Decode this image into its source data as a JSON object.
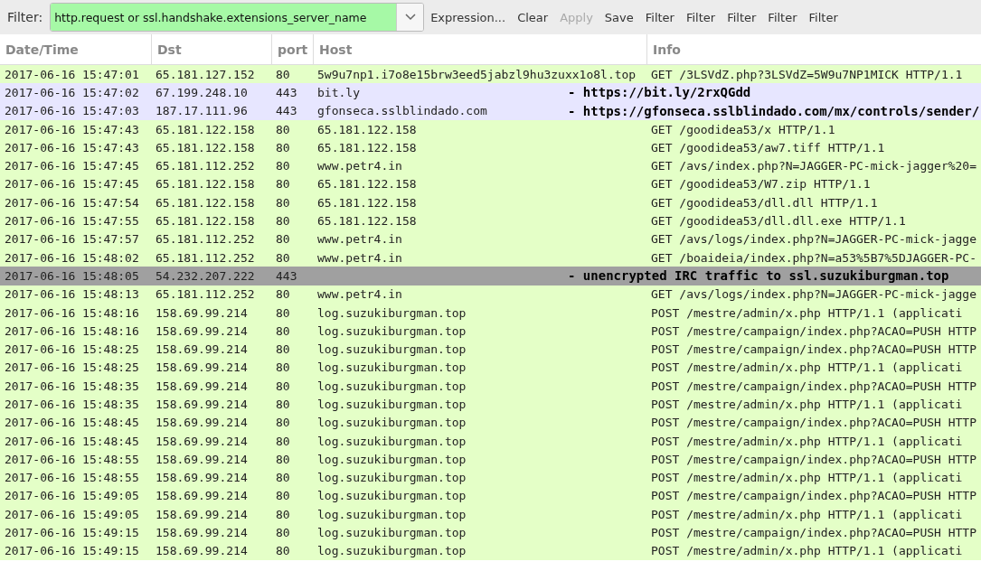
{
  "toolbar": {
    "label": "Filter:",
    "filter": {
      "value": "http.request or ssl.handshake.extensions_server_name",
      "valid": true
    },
    "buttons": [
      {
        "label": "Expression...",
        "disabled": false
      },
      {
        "label": "Clear",
        "disabled": false
      },
      {
        "label": "Apply",
        "disabled": true
      },
      {
        "label": "Save",
        "disabled": false
      },
      {
        "label": "Filter",
        "disabled": false
      },
      {
        "label": "Filter",
        "disabled": false
      },
      {
        "label": "Filter",
        "disabled": false
      },
      {
        "label": "Filter",
        "disabled": false
      },
      {
        "label": "Filter",
        "disabled": false
      }
    ]
  },
  "table": {
    "columns": [
      "Date/Time",
      "Dst",
      "port",
      "Host",
      "Info"
    ],
    "rows": [
      {
        "kind": "http",
        "color": "#e4ffc7",
        "time": "2017-06-16 15:47:01",
        "dst": "65.181.127.152",
        "port": "80",
        "host": "5w9u7np1.i7o8e15brw3eed5jabzl9hu3zuxx1o8l.top",
        "info": "GET /3LSVdZ.php?3LSVdZ=5W9u7NP1MICK HTTP/1.1"
      },
      {
        "kind": "ssl",
        "color": "#e7e6ff",
        "time": "2017-06-16 15:47:02",
        "dst": "67.199.248.10",
        "port": "443",
        "host": "bit.ly",
        "info": "- https://bit.ly/2rxQGdd"
      },
      {
        "kind": "ssl",
        "color": "#e7e6ff",
        "time": "2017-06-16 15:47:03",
        "dst": "187.17.111.96",
        "port": "443",
        "host": "gfonseca.sslblindado.com",
        "info": "- https://gfonseca.sslblindado.com/mx/controls/sender/"
      },
      {
        "kind": "http",
        "color": "#e4ffc7",
        "time": "2017-06-16 15:47:43",
        "dst": "65.181.122.158",
        "port": "80",
        "host": "65.181.122.158",
        "info": "GET /goodidea53/x HTTP/1.1"
      },
      {
        "kind": "http",
        "color": "#e4ffc7",
        "time": "2017-06-16 15:47:43",
        "dst": "65.181.122.158",
        "port": "80",
        "host": "65.181.122.158",
        "info": "GET /goodidea53/aw7.tiff HTTP/1.1"
      },
      {
        "kind": "http",
        "color": "#e4ffc7",
        "time": "2017-06-16 15:47:45",
        "dst": "65.181.112.252",
        "port": "80",
        "host": "www.petr4.in",
        "info": "GET /avs/index.php?N=JAGGER-PC-mick-jagger%20="
      },
      {
        "kind": "http",
        "color": "#e4ffc7",
        "time": "2017-06-16 15:47:45",
        "dst": "65.181.122.158",
        "port": "80",
        "host": "65.181.122.158",
        "info": "GET /goodidea53/W7.zip HTTP/1.1"
      },
      {
        "kind": "http",
        "color": "#e4ffc7",
        "time": "2017-06-16 15:47:54",
        "dst": "65.181.122.158",
        "port": "80",
        "host": "65.181.122.158",
        "info": "GET /goodidea53/dll.dll HTTP/1.1"
      },
      {
        "kind": "http",
        "color": "#e4ffc7",
        "time": "2017-06-16 15:47:55",
        "dst": "65.181.122.158",
        "port": "80",
        "host": "65.181.122.158",
        "info": "GET /goodidea53/dll.dll.exe HTTP/1.1"
      },
      {
        "kind": "http",
        "color": "#e4ffc7",
        "time": "2017-06-16 15:47:57",
        "dst": "65.181.112.252",
        "port": "80",
        "host": "www.petr4.in",
        "info": "GET /avs/logs/index.php?N=JAGGER-PC-mick-jagge"
      },
      {
        "kind": "http",
        "color": "#e4ffc7",
        "time": "2017-06-16 15:48:02",
        "dst": "65.181.112.252",
        "port": "80",
        "host": "www.petr4.in",
        "info": "GET /boaideia/index.php?N=a53%5B7%5DJAGGER-PC-"
      },
      {
        "kind": "irc",
        "color": "#a0a0a0",
        "time": "2017-06-16 15:48:05",
        "dst": "54.232.207.222",
        "port": "443",
        "info": "- unencrypted IRC traffic to ssl.suzukiburgman.top"
      },
      {
        "kind": "http",
        "color": "#e4ffc7",
        "time": "2017-06-16 15:48:13",
        "dst": "65.181.112.252",
        "port": "80",
        "host": "www.petr4.in",
        "info": "GET /avs/logs/index.php?N=JAGGER-PC-mick-jagge"
      },
      {
        "kind": "http",
        "color": "#e4ffc7",
        "time": "2017-06-16 15:48:16",
        "dst": "158.69.99.214",
        "port": "80",
        "host": "log.suzukiburgman.top",
        "info": "POST /mestre/admin/x.php HTTP/1.1  (applicati"
      },
      {
        "kind": "http",
        "color": "#e4ffc7",
        "time": "2017-06-16 15:48:16",
        "dst": "158.69.99.214",
        "port": "80",
        "host": "log.suzukiburgman.top",
        "info": "POST /mestre/campaign/index.php?ACAO=PUSH HTTP"
      },
      {
        "kind": "http",
        "color": "#e4ffc7",
        "time": "2017-06-16 15:48:25",
        "dst": "158.69.99.214",
        "port": "80",
        "host": "log.suzukiburgman.top",
        "info": "POST /mestre/campaign/index.php?ACAO=PUSH HTTP"
      },
      {
        "kind": "http",
        "color": "#e4ffc7",
        "time": "2017-06-16 15:48:25",
        "dst": "158.69.99.214",
        "port": "80",
        "host": "log.suzukiburgman.top",
        "info": "POST /mestre/admin/x.php HTTP/1.1  (applicati"
      },
      {
        "kind": "http",
        "color": "#e4ffc7",
        "time": "2017-06-16 15:48:35",
        "dst": "158.69.99.214",
        "port": "80",
        "host": "log.suzukiburgman.top",
        "info": "POST /mestre/campaign/index.php?ACAO=PUSH HTTP"
      },
      {
        "kind": "http",
        "color": "#e4ffc7",
        "time": "2017-06-16 15:48:35",
        "dst": "158.69.99.214",
        "port": "80",
        "host": "log.suzukiburgman.top",
        "info": "POST /mestre/admin/x.php HTTP/1.1  (applicati"
      },
      {
        "kind": "http",
        "color": "#e4ffc7",
        "time": "2017-06-16 15:48:45",
        "dst": "158.69.99.214",
        "port": "80",
        "host": "log.suzukiburgman.top",
        "info": "POST /mestre/campaign/index.php?ACAO=PUSH HTTP"
      },
      {
        "kind": "http",
        "color": "#e4ffc7",
        "time": "2017-06-16 15:48:45",
        "dst": "158.69.99.214",
        "port": "80",
        "host": "log.suzukiburgman.top",
        "info": "POST /mestre/admin/x.php HTTP/1.1  (applicati"
      },
      {
        "kind": "http",
        "color": "#e4ffc7",
        "time": "2017-06-16 15:48:55",
        "dst": "158.69.99.214",
        "port": "80",
        "host": "log.suzukiburgman.top",
        "info": "POST /mestre/campaign/index.php?ACAO=PUSH HTTP"
      },
      {
        "kind": "http",
        "color": "#e4ffc7",
        "time": "2017-06-16 15:48:55",
        "dst": "158.69.99.214",
        "port": "80",
        "host": "log.suzukiburgman.top",
        "info": "POST /mestre/admin/x.php HTTP/1.1  (applicati"
      },
      {
        "kind": "http",
        "color": "#e4ffc7",
        "time": "2017-06-16 15:49:05",
        "dst": "158.69.99.214",
        "port": "80",
        "host": "log.suzukiburgman.top",
        "info": "POST /mestre/campaign/index.php?ACAO=PUSH HTTP"
      },
      {
        "kind": "http",
        "color": "#e4ffc7",
        "time": "2017-06-16 15:49:05",
        "dst": "158.69.99.214",
        "port": "80",
        "host": "log.suzukiburgman.top",
        "info": "POST /mestre/admin/x.php HTTP/1.1  (applicati"
      },
      {
        "kind": "http",
        "color": "#e4ffc7",
        "time": "2017-06-16 15:49:15",
        "dst": "158.69.99.214",
        "port": "80",
        "host": "log.suzukiburgman.top",
        "info": "POST /mestre/campaign/index.php?ACAO=PUSH HTTP"
      },
      {
        "kind": "http",
        "color": "#e4ffc7",
        "time": "2017-06-16 15:49:15",
        "dst": "158.69.99.214",
        "port": "80",
        "host": "log.suzukiburgman.top",
        "info": "POST /mestre/admin/x.php HTTP/1.1  (applicati"
      }
    ]
  }
}
